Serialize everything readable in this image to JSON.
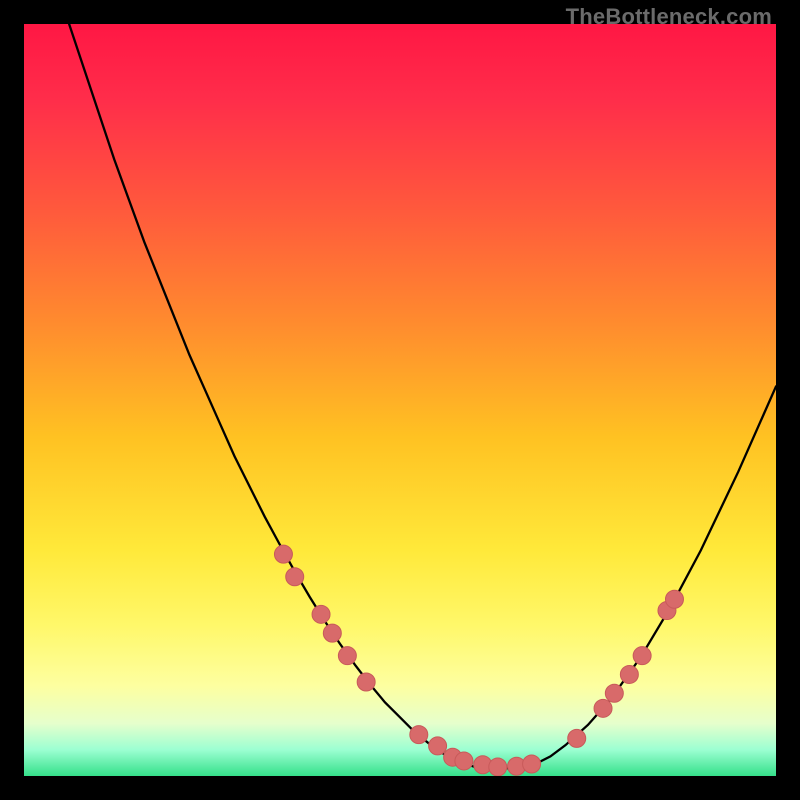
{
  "watermark": "TheBottleneck.com",
  "colors": {
    "gradient_stops": [
      {
        "offset": 0.0,
        "color": "#ff1744"
      },
      {
        "offset": 0.1,
        "color": "#ff2d4a"
      },
      {
        "offset": 0.25,
        "color": "#ff5a3c"
      },
      {
        "offset": 0.4,
        "color": "#ff8c2e"
      },
      {
        "offset": 0.55,
        "color": "#ffc222"
      },
      {
        "offset": 0.7,
        "color": "#ffe93a"
      },
      {
        "offset": 0.8,
        "color": "#fff86a"
      },
      {
        "offset": 0.88,
        "color": "#fdffa0"
      },
      {
        "offset": 0.93,
        "color": "#e6ffcc"
      },
      {
        "offset": 0.965,
        "color": "#9cffd2"
      },
      {
        "offset": 1.0,
        "color": "#35e08a"
      }
    ],
    "curve": "#000000",
    "marker_fill": "#d86a6a",
    "marker_stroke": "#c85a5a"
  },
  "chart_data": {
    "type": "line",
    "title": "",
    "xlabel": "",
    "ylabel": "",
    "xlim": [
      0,
      100
    ],
    "ylim": [
      0,
      100
    ],
    "grid": false,
    "legend": false,
    "series": [
      {
        "name": "bottleneck-curve",
        "x": [
          6,
          8,
          10,
          12,
          14,
          16,
          18,
          20,
          22,
          24,
          26,
          28,
          30,
          32,
          34,
          36,
          38,
          40,
          42,
          44,
          46,
          48,
          50,
          52,
          54,
          56,
          58,
          60,
          62,
          64,
          66,
          68,
          70,
          72,
          75,
          78,
          82,
          86,
          90,
          95,
          100
        ],
        "y": [
          100,
          94,
          88,
          82,
          76.5,
          71,
          66,
          61,
          56,
          51.5,
          47,
          42.5,
          38.5,
          34.5,
          30.8,
          27.2,
          23.8,
          20.6,
          17.6,
          14.8,
          12.2,
          9.8,
          7.8,
          5.8,
          4.2,
          2.8,
          1.8,
          1.2,
          1.0,
          1.0,
          1.2,
          1.6,
          2.6,
          4.1,
          6.8,
          10.2,
          15.8,
          22.5,
          30.0,
          40.5,
          51.8
        ]
      }
    ],
    "markers": [
      {
        "x": 34.5,
        "y": 29.5
      },
      {
        "x": 36.0,
        "y": 26.5
      },
      {
        "x": 39.5,
        "y": 21.5
      },
      {
        "x": 41.0,
        "y": 19.0
      },
      {
        "x": 43.0,
        "y": 16.0
      },
      {
        "x": 45.5,
        "y": 12.5
      },
      {
        "x": 52.5,
        "y": 5.5
      },
      {
        "x": 55.0,
        "y": 4.0
      },
      {
        "x": 57.0,
        "y": 2.5
      },
      {
        "x": 58.5,
        "y": 2.0
      },
      {
        "x": 61.0,
        "y": 1.5
      },
      {
        "x": 63.0,
        "y": 1.2
      },
      {
        "x": 65.5,
        "y": 1.3
      },
      {
        "x": 67.5,
        "y": 1.6
      },
      {
        "x": 73.5,
        "y": 5.0
      },
      {
        "x": 77.0,
        "y": 9.0
      },
      {
        "x": 78.5,
        "y": 11.0
      },
      {
        "x": 80.5,
        "y": 13.5
      },
      {
        "x": 82.2,
        "y": 16.0
      },
      {
        "x": 85.5,
        "y": 22.0
      },
      {
        "x": 86.5,
        "y": 23.5
      }
    ]
  }
}
